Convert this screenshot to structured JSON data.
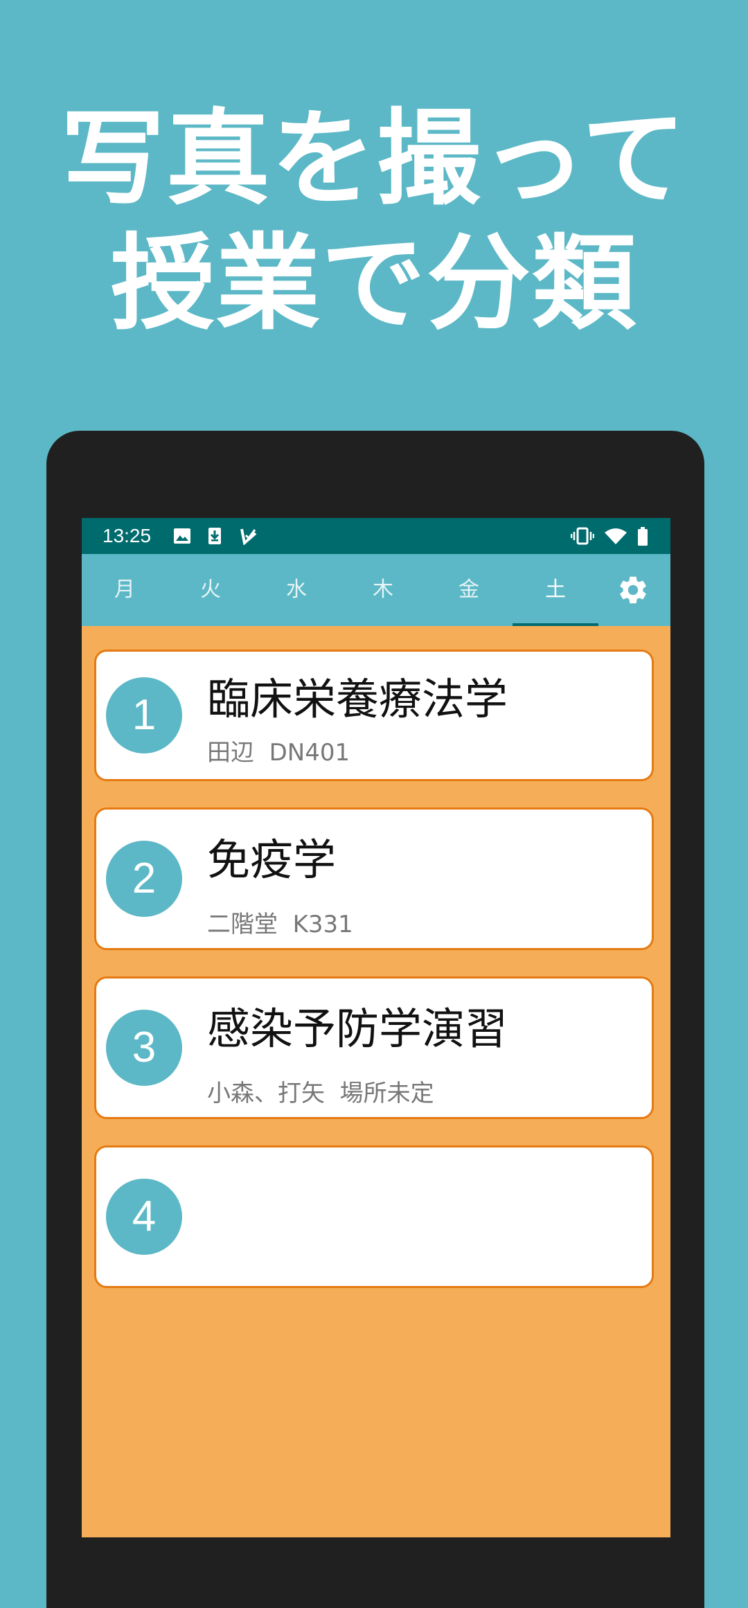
{
  "headline": {
    "line1": "写真を撮って",
    "line2": "授業で分類"
  },
  "status_bar": {
    "time": "13:25",
    "icons": [
      "image-icon",
      "download-icon",
      "check-icon",
      "vibrate-icon",
      "wifi-icon",
      "battery-icon"
    ]
  },
  "tabs": [
    {
      "label": "月",
      "active": false
    },
    {
      "label": "火",
      "active": false
    },
    {
      "label": "水",
      "active": false
    },
    {
      "label": "木",
      "active": false
    },
    {
      "label": "金",
      "active": false
    },
    {
      "label": "土",
      "active": true
    }
  ],
  "settings_icon": "gear-icon",
  "courses": [
    {
      "period": "1",
      "title": "臨床栄養療法学",
      "teacher": "田辺",
      "room": "DN401"
    },
    {
      "period": "2",
      "title": "免疫学",
      "teacher": "二階堂",
      "room": "K331"
    },
    {
      "period": "3",
      "title": "感染予防学演習",
      "teacher": "小森、打矢",
      "room": "場所未定"
    },
    {
      "period": "4",
      "title": "",
      "teacher": "",
      "room": ""
    }
  ],
  "colors": {
    "background": "#5cb8c6",
    "status_bar": "#006b6d",
    "list_background": "#f5ae57",
    "card_border": "#e57a12",
    "period_circle": "#5cb8c6"
  }
}
